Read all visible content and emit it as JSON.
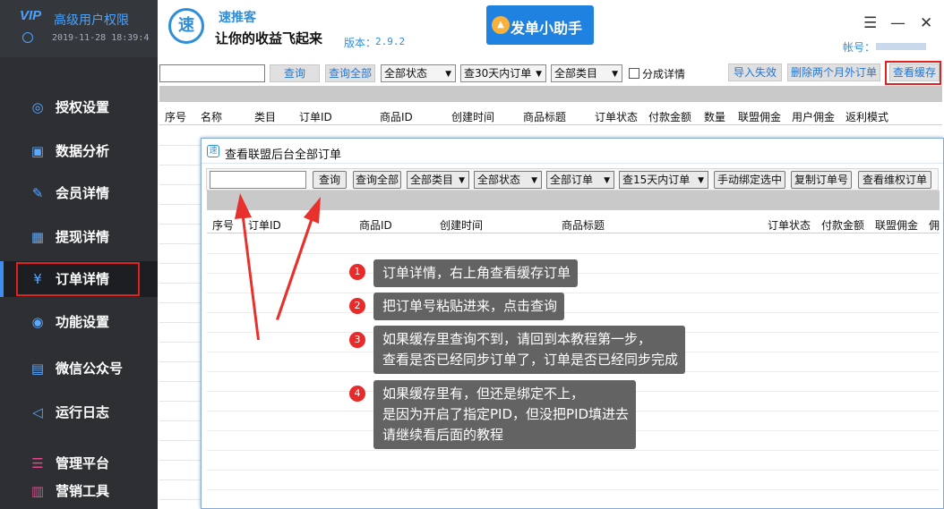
{
  "vip": {
    "title": "高级用户权限",
    "time": "2019-11-28 18:39:4",
    "logo": "VIP"
  },
  "sidebar": {
    "items": [
      {
        "label": "授权设置",
        "icon": "globe-icon",
        "glyph": "◎"
      },
      {
        "label": "数据分析",
        "icon": "chart-monitor-icon",
        "glyph": "▣"
      },
      {
        "label": "会员详情",
        "icon": "edit-icon",
        "glyph": "✎"
      },
      {
        "label": "提现详情",
        "icon": "grid-search-icon",
        "glyph": "▦"
      },
      {
        "label": "订单详情",
        "icon": "wallet-yen-icon",
        "glyph": "¥"
      },
      {
        "label": "功能设置",
        "icon": "chat-icon",
        "glyph": "◉"
      },
      {
        "label": "微信公众号",
        "icon": "keyboard-icon",
        "glyph": "▤"
      },
      {
        "label": "运行日志",
        "icon": "speaker-icon",
        "glyph": "◁"
      },
      {
        "label": "管理平台",
        "icon": "server-icon",
        "glyph": "☰"
      },
      {
        "label": "营销工具",
        "icon": "bar-chart-icon",
        "glyph": "▥"
      }
    ]
  },
  "header": {
    "logo_char": "速",
    "brand": "速推客",
    "slogan": "让你的收益飞起来",
    "version_label": "版本：",
    "version": "2.9.2",
    "fadan_label": "发单小助手",
    "account_label": "帐号：",
    "menu_glyph": "☰",
    "min_glyph": "—",
    "close_glyph": "✕"
  },
  "toolbar": {
    "search_label": "查询",
    "query_all_label": "查询全部",
    "status_select": "全部状态",
    "days_select": "查30天内订单",
    "category_select": "全部类目",
    "split_detail_label": "分成详情",
    "import_fail_label": "导入失效",
    "delete_old_label": "删除两个月外订单",
    "view_cache_label": "查看缓存"
  },
  "main_table": {
    "columns": [
      "序号",
      "名称",
      "类目",
      "订单ID",
      "商品ID",
      "创建时间",
      "商品标题",
      "订单状态",
      "付款金额",
      "数量",
      "联盟佣金",
      "用户佣金",
      "返利模式"
    ]
  },
  "dialog": {
    "title": "查看联盟后台全部订单",
    "search_label": "查询",
    "query_all_label": "查询全部",
    "category_select": "全部类目",
    "status_select": "全部状态",
    "order_select": "全部订单",
    "days_select": "查15天内订单",
    "manual_bind_label": "手动绑定选中",
    "copy_order_label": "复制订单号",
    "view_rights_label": "查看维权订单",
    "columns": [
      "序号",
      "订单ID",
      "商品ID",
      "创建时间",
      "商品标题",
      "订单状态",
      "付款金额",
      "联盟佣金",
      "佣金"
    ]
  },
  "notes": [
    {
      "num": "1",
      "lines": [
        "订单详情，右上角查看缓存订单"
      ]
    },
    {
      "num": "2",
      "lines": [
        "把订单号粘贴进来，点击查询"
      ]
    },
    {
      "num": "3",
      "lines": [
        "如果缓存里查询不到，请回到本教程第一步，",
        "查看是否已经同步订单了，订单是否已经同步完成"
      ]
    },
    {
      "num": "4",
      "lines": [
        "如果缓存里有，但还是绑定不上，",
        "是因为开启了指定PID，但没把PID填进去",
        "请继续看后面的教程"
      ]
    }
  ]
}
